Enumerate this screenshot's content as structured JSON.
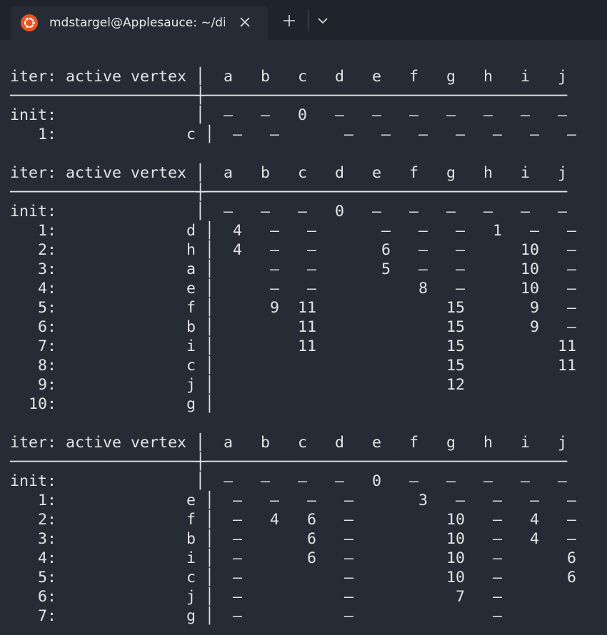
{
  "tab": {
    "title": "mdstargel@Applesauce: ~/dij",
    "icon": "ubuntu-icon",
    "close_icon": "close-icon",
    "new_tab_icon": "plus-icon",
    "dropdown_icon": "chevron-down-icon"
  },
  "terminal": {
    "lines": [
      "iter: active vertex │  a   b   c   d   e   f   g   h   i   j",
      "────────────────────┼───────────────────────────────────────",
      "init:               │  –   –   0   –   –   –   –   –   –   –",
      "   1:              c │  –   –       –   –   –   –   –   –   –",
      "",
      "iter: active vertex │  a   b   c   d   e   f   g   h   i   j",
      "────────────────────┼───────────────────────────────────────",
      "init:               │  –   –   –   0   –   –   –   –   –   –",
      "   1:              d │  4   –   –       –   –   –   1   –   –",
      "   2:              h │  4   –   –       6   –   –      10   –",
      "   3:              a │      –   –       5   –   –      10   –",
      "   4:              e │      –   –           8   –      10   –",
      "   5:              f │      9  11              15       9   –",
      "   6:              b │         11              15       9   –",
      "   7:              i │         11              15          11",
      "   8:              c │                         15          11",
      "   9:              j │                         12",
      "  10:              g │",
      "",
      "iter: active vertex │  a   b   c   d   e   f   g   h   i   j",
      "────────────────────┼───────────────────────────────────────",
      "init:               │  –   –   –   –   0   –   –   –   –   –",
      "   1:              e │  –   –   –   –       3   –   –   –   –",
      "   2:              f │  –   4   6   –          10   –   4   –",
      "   3:              b │  –       6   –          10   –   4   –",
      "   4:              i │  –       6   –          10   –       6",
      "   5:              c │  –           –          10   –       6",
      "   6:              j │  –           –           7   –",
      "   7:              g │  –           –               –"
    ]
  }
}
